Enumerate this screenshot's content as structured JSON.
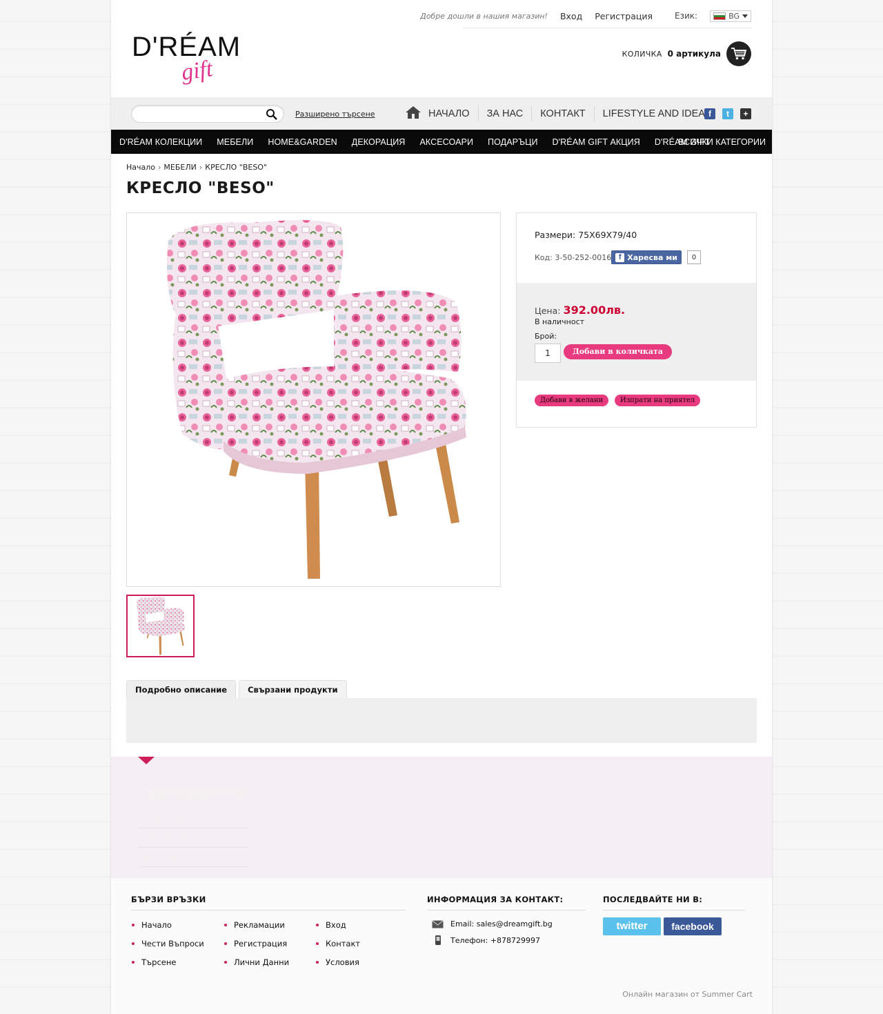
{
  "header": {
    "welcome": "Добре дошли в нашия магазин!",
    "login": "Вход",
    "register": "Регистрация",
    "language_label": "Език:",
    "language_value": "BG",
    "logo_dream": "D'RÉAM",
    "logo_gift": "gift",
    "cart_label": "КОЛИЧКА",
    "cart_count": "0 артикула"
  },
  "search": {
    "placeholder": "",
    "advanced": "Разширено търсене"
  },
  "main_nav": [
    "НАЧАЛО",
    "ЗА НАС",
    "КОНТАКТ",
    "LIFESTYLE AND IDEAS"
  ],
  "categories": [
    "D'RÉAM КОЛЕКЦИИ",
    "МЕБЕЛИ",
    "HOME&GARDEN",
    "ДЕКОРАЦИЯ",
    "АКСЕСОАРИ",
    "ПОДАРЪЦИ",
    "D'RÉAM GIFT АКЦИЯ",
    "D'RÉAM GIFT"
  ],
  "all_categories": "ВСИЧКИ КАТЕГОРИИ",
  "breadcrumb": [
    "Начало",
    "МЕБЕЛИ",
    "КРЕСЛО \"BESO\""
  ],
  "product": {
    "title": "КРЕСЛО \"BESO\"",
    "dimensions": "Размери: 75X69X79/40",
    "code": "Код: 3-50-252-0016",
    "fb_like": "Харесва ми",
    "fb_count": "0",
    "price_label": "Цена:",
    "price": "392.00лв.",
    "stock": "В наличност",
    "qty_label": "Брой:",
    "qty_value": "1",
    "add_to_cart": "Добави в количката",
    "wishlist": "Добави в желани",
    "send_friend": "Изпрати на приятел"
  },
  "tabs": [
    "Подробно описание",
    "Свързани продукти"
  ],
  "manufacturers": {
    "title": "Производители",
    "items": [
      "DreamGift",
      "D'REAM gift",
      "TestManufacturer"
    ]
  },
  "footer": {
    "quick_links_title": "БЪРЗИ ВРЪЗКИ",
    "quick_links": [
      [
        "Начало",
        "Рекламации",
        "Вход"
      ],
      [
        "Чести Въпроси",
        "Регистрация",
        "Контакт"
      ],
      [
        "Търсене",
        "Лични Данни",
        "Условия"
      ]
    ],
    "contact_title": "ИНФОРМАЦИЯ ЗА КОНТАКТ:",
    "email": "Email: sales@dreamgift.bg",
    "phone": "Телефон: +878729997",
    "follow_title": "ПОСЛЕДВАЙТЕ НИ В:",
    "twitter": "twitter",
    "facebook": "facebook",
    "credit": "Онлайн магазин от Summer Cart"
  },
  "colors": {
    "accent": "#e83a7f",
    "price": "#cc0033",
    "nav_bg": "#0a0a0a"
  }
}
